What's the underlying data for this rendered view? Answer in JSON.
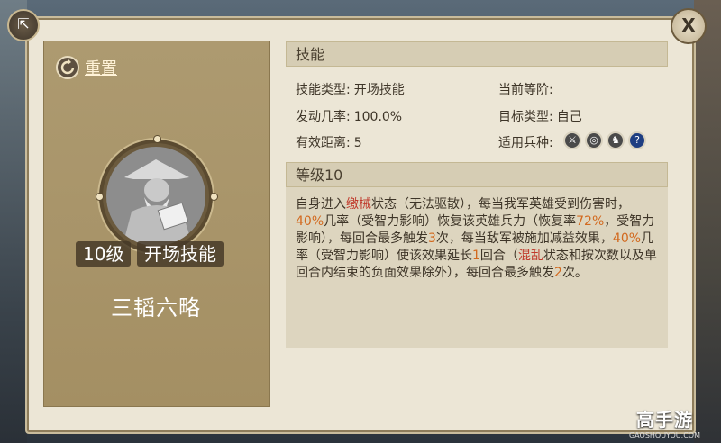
{
  "header": {
    "share_icon": "share-icon",
    "close_label": "X"
  },
  "left": {
    "reset_label": "重置",
    "level_tag": "10级",
    "type_tag": "开场技能",
    "skill_name": "三韬六略"
  },
  "skill_section": {
    "title": "技能",
    "skill_type_label": "技能类型:",
    "skill_type_value": "开场技能",
    "current_rank_label": "当前等阶:",
    "current_rank_value": "",
    "trigger_rate_label": "发动几率:",
    "trigger_rate_value": "100.0%",
    "target_type_label": "目标类型:",
    "target_type_value": "自己",
    "range_label": "有效距离:",
    "range_value": "5",
    "troop_types_label": "适用兵种:",
    "troops": [
      "sword-icon",
      "bow-target-icon",
      "horse-icon",
      "question-icon"
    ],
    "troop_glyphs": [
      "⚔",
      "◎",
      "♞",
      "?"
    ]
  },
  "level_section": {
    "title": "等级10",
    "desc": [
      {
        "t": "自身进入",
        "c": ""
      },
      {
        "t": "缴械",
        "c": "red"
      },
      {
        "t": "状态（无法驱散），每当我军英雄受到伤害时，",
        "c": ""
      },
      {
        "t": "40%",
        "c": "orange"
      },
      {
        "t": "几率（受智力影响）恢复该英雄兵力（恢复率",
        "c": ""
      },
      {
        "t": "72%",
        "c": "orange"
      },
      {
        "t": "，受智力影响），每回合最多触发",
        "c": ""
      },
      {
        "t": "3",
        "c": "orange"
      },
      {
        "t": "次，每当敌军被施加减益效果，",
        "c": ""
      },
      {
        "t": "40%",
        "c": "orange"
      },
      {
        "t": "几率（受智力影响）使该效果延长",
        "c": ""
      },
      {
        "t": "1",
        "c": "orange"
      },
      {
        "t": "回合（",
        "c": ""
      },
      {
        "t": "混乱",
        "c": "red"
      },
      {
        "t": "状态和按次数以及单回合内结束的负面效果除外），每回合最多触发",
        "c": ""
      },
      {
        "t": "2",
        "c": "orange"
      },
      {
        "t": "次。",
        "c": ""
      }
    ]
  },
  "watermark": {
    "title": "高手游",
    "url": "GAOSHOUYOU.COM"
  }
}
